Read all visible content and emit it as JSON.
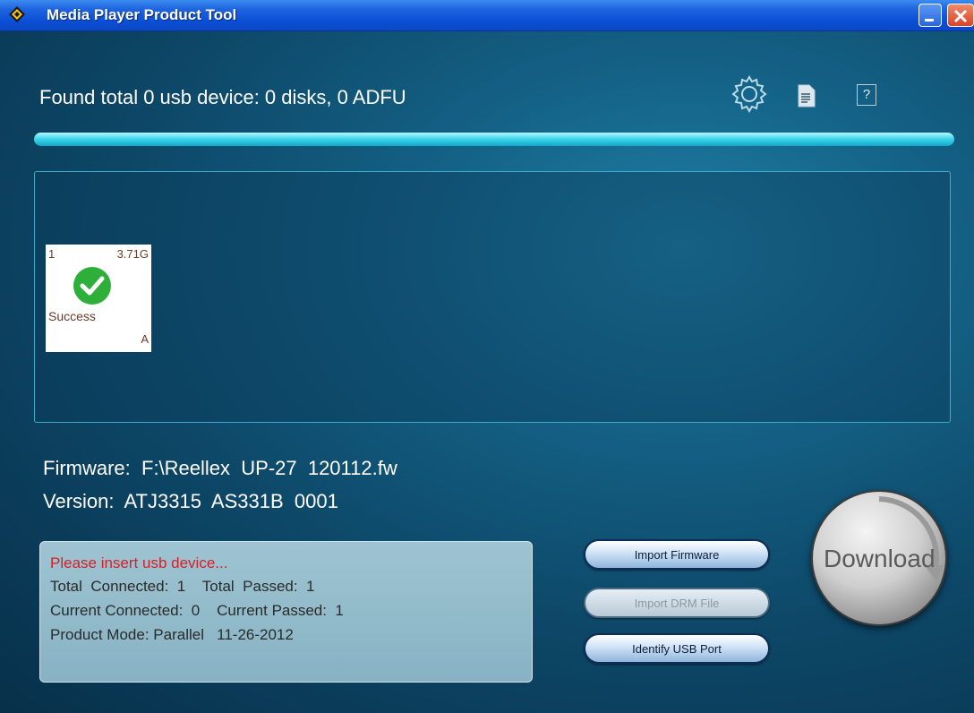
{
  "window": {
    "title": "Media Player Product Tool"
  },
  "header": {
    "found_text": "Found total 0 usb device: 0 disks, 0 ADFU",
    "icons": [
      "settings-gear-icon",
      "document-icon",
      "help-icon"
    ],
    "help_glyph": "?",
    "progress_fraction": 1.0
  },
  "devices": [
    {
      "index": "1",
      "size": "3.71G",
      "status": "Success",
      "drive": "A"
    }
  ],
  "firmware": {
    "firmware_line": "Firmware:  F:\\Reellex  UP-27  120112.fw",
    "version_line": "Version:  ATJ3315  AS331B  0001"
  },
  "status": {
    "message": "Please insert usb device...",
    "line1": "Total  Connected:  1    Total  Passed:  1",
    "line2": "Current Connected:  0    Current Passed:  1",
    "line3": "Product Mode: Parallel   11-26-2012"
  },
  "buttons": {
    "import_firmware": "Import Firmware",
    "import_drm": "Import DRM File",
    "identify_usb": "Identify USB Port",
    "download": "Download"
  },
  "colors": {
    "accent": "#38d3ea",
    "status_error": "#d4202a",
    "success": "#2eaf3a"
  }
}
